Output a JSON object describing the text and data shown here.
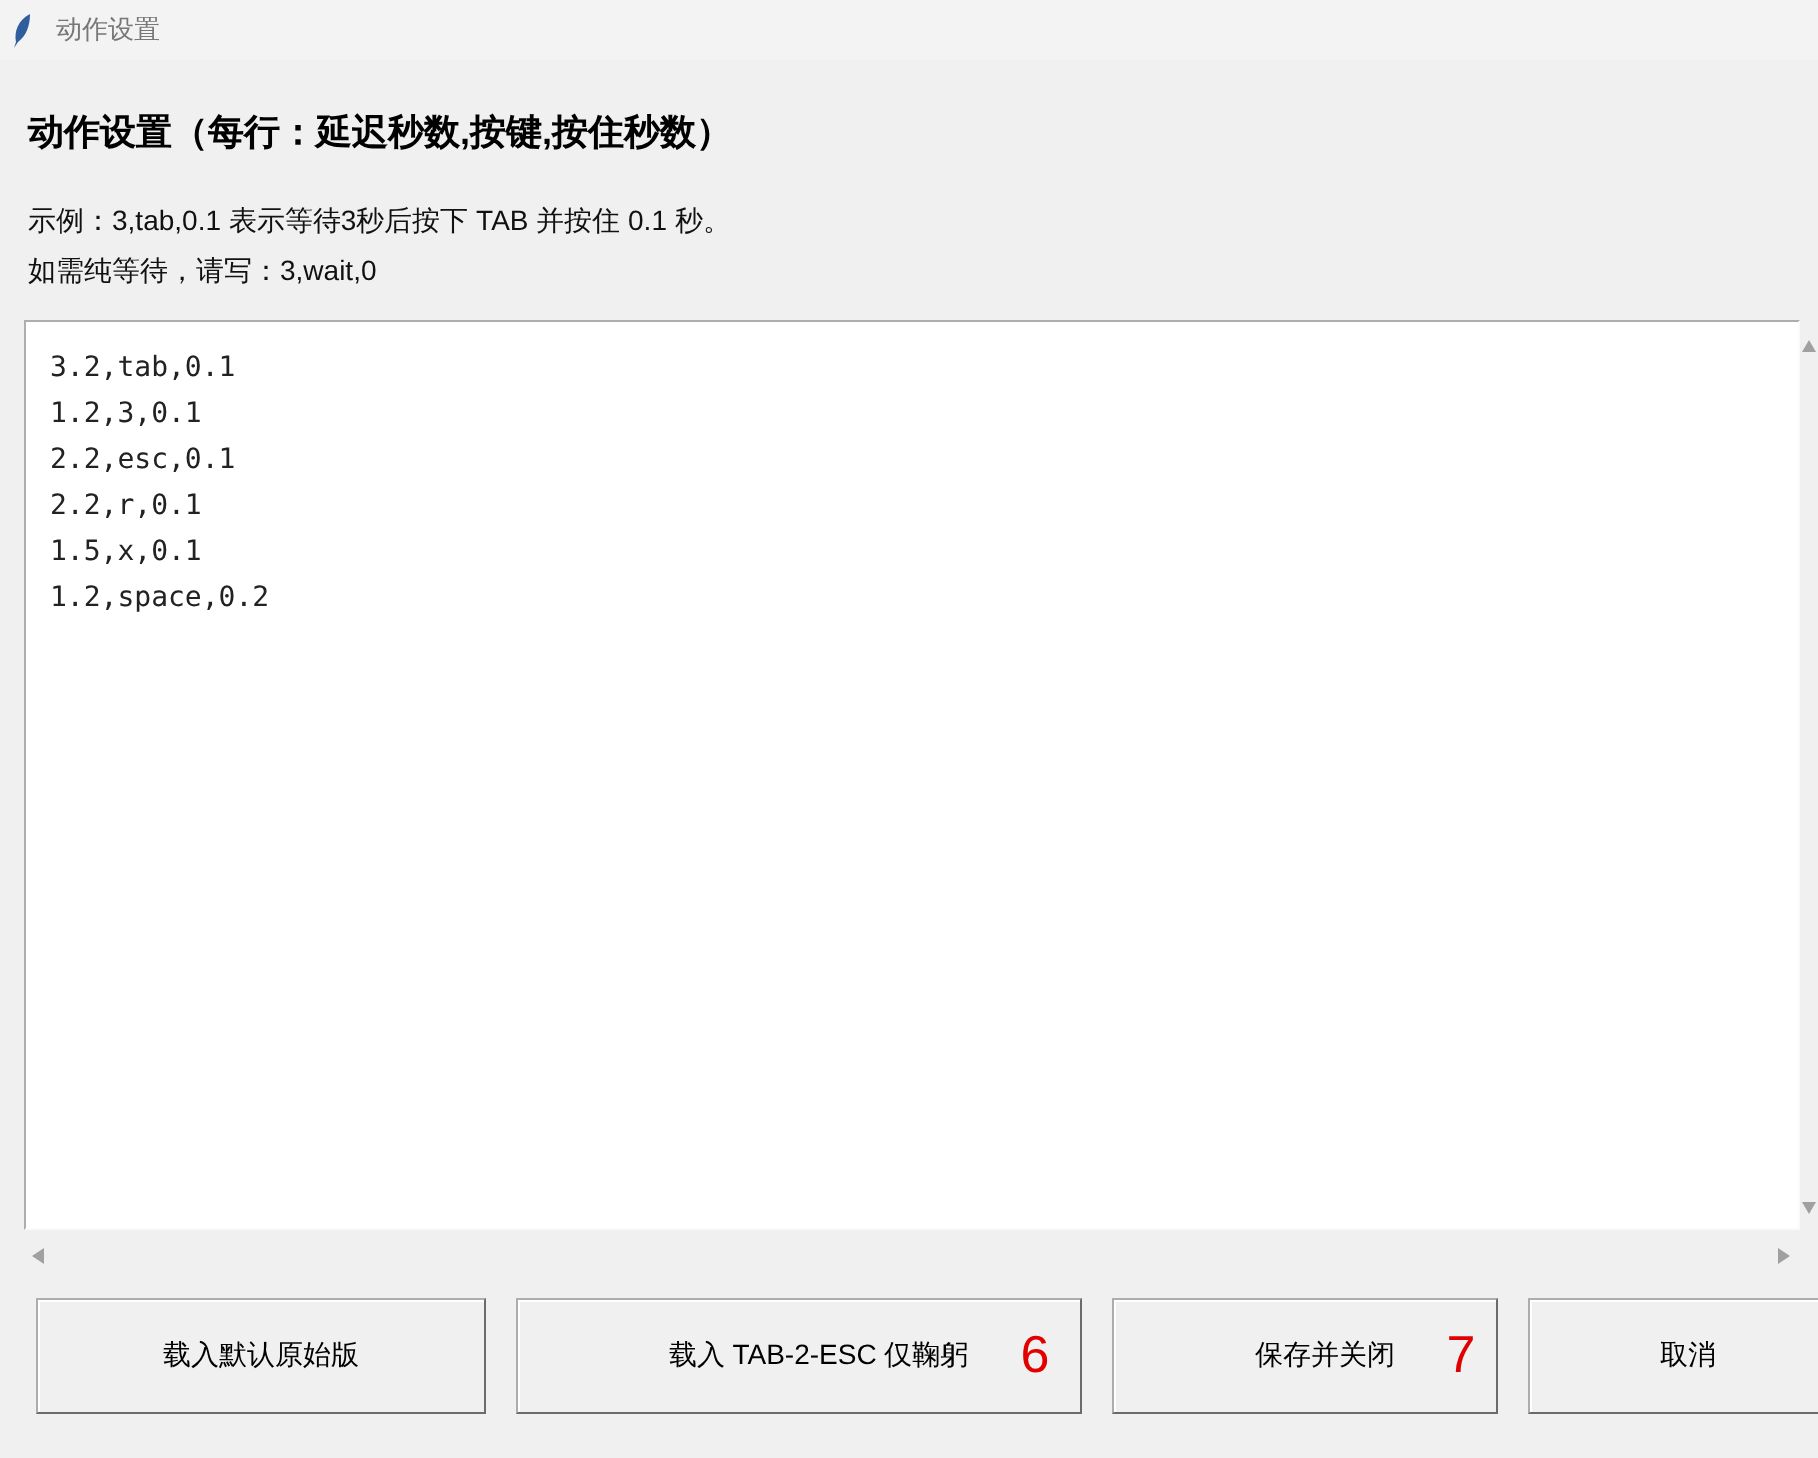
{
  "window": {
    "title": "动作设置"
  },
  "heading": "动作设置（每行：延迟秒数,按键,按住秒数）",
  "hints": [
    "示例：3,tab,0.1 表示等待3秒后按下 TAB 并按住 0.1 秒。",
    "如需纯等待，请写：3,wait,0"
  ],
  "editor": {
    "lines": [
      "3.2,tab,0.1",
      "1.2,3,0.1",
      "2.2,esc,0.1",
      "2.2,r,0.1",
      "1.5,x,0.1",
      "1.2,space,0.2"
    ]
  },
  "buttons": [
    {
      "label": "载入默认原始版"
    },
    {
      "label": "载入 TAB-2-ESC 仅鞠躬",
      "note": "6"
    },
    {
      "label": "保存并关闭",
      "note": "7"
    },
    {
      "label": "取消"
    }
  ]
}
